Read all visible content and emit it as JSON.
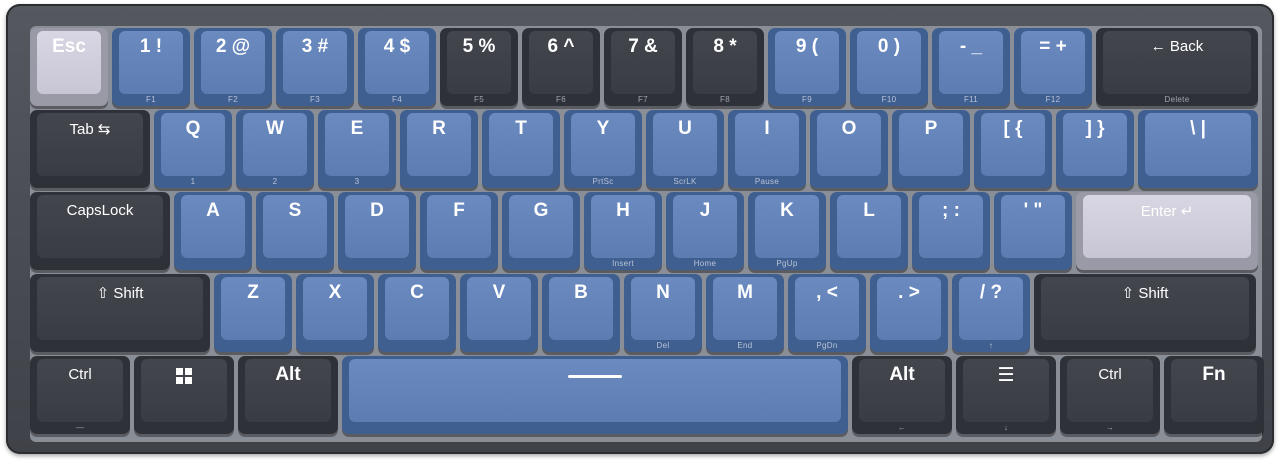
{
  "keyboard": {
    "rows": [
      [
        {
          "label": "Esc",
          "sub": "",
          "color": "light"
        },
        {
          "label": "1 !",
          "sub": "F1",
          "color": "blue"
        },
        {
          "label": "2 @",
          "sub": "F2",
          "color": "blue"
        },
        {
          "label": "3 #",
          "sub": "F3",
          "color": "blue"
        },
        {
          "label": "4 $",
          "sub": "F4",
          "color": "blue"
        },
        {
          "label": "5 %",
          "sub": "F5",
          "color": "dark"
        },
        {
          "label": "6 ^",
          "sub": "F6",
          "color": "dark"
        },
        {
          "label": "7 &",
          "sub": "F7",
          "color": "dark"
        },
        {
          "label": "8 *",
          "sub": "F8",
          "color": "dark"
        },
        {
          "label": "9 (",
          "sub": "F9",
          "color": "blue"
        },
        {
          "label": "0 )",
          "sub": "F10",
          "color": "blue"
        },
        {
          "label": "- _",
          "sub": "F11",
          "color": "blue"
        },
        {
          "label": "= +",
          "sub": "F12",
          "color": "blue"
        },
        {
          "label": "← Back",
          "sub": "Delete",
          "color": "dark"
        }
      ],
      [
        {
          "label": "Tab ⇆",
          "sub": "",
          "color": "dark"
        },
        {
          "label": "Q",
          "sub": "1",
          "color": "blue"
        },
        {
          "label": "W",
          "sub": "2",
          "color": "blue"
        },
        {
          "label": "E",
          "sub": "3",
          "color": "blue"
        },
        {
          "label": "R",
          "sub": "",
          "color": "blue"
        },
        {
          "label": "T",
          "sub": "",
          "color": "blue"
        },
        {
          "label": "Y",
          "sub": "PrtSc",
          "color": "blue"
        },
        {
          "label": "U",
          "sub": "ScrLK",
          "color": "blue"
        },
        {
          "label": "I",
          "sub": "Pause",
          "color": "blue"
        },
        {
          "label": "O",
          "sub": "",
          "color": "blue"
        },
        {
          "label": "P",
          "sub": "",
          "color": "blue"
        },
        {
          "label": "[ {",
          "sub": "",
          "color": "blue"
        },
        {
          "label": "] }",
          "sub": "",
          "color": "blue"
        },
        {
          "label": "\\ |",
          "sub": "",
          "color": "blue"
        }
      ],
      [
        {
          "label": "CapsLock",
          "sub": "",
          "color": "dark"
        },
        {
          "label": "A",
          "sub": "",
          "color": "blue"
        },
        {
          "label": "S",
          "sub": "",
          "color": "blue"
        },
        {
          "label": "D",
          "sub": "",
          "color": "blue"
        },
        {
          "label": "F",
          "sub": "",
          "color": "blue"
        },
        {
          "label": "G",
          "sub": "",
          "color": "blue"
        },
        {
          "label": "H",
          "sub": "Insert",
          "color": "blue"
        },
        {
          "label": "J",
          "sub": "Home",
          "color": "blue"
        },
        {
          "label": "K",
          "sub": "PgUp",
          "color": "blue"
        },
        {
          "label": "L",
          "sub": "",
          "color": "blue"
        },
        {
          "label": "; :",
          "sub": "",
          "color": "blue"
        },
        {
          "label": "' \"",
          "sub": "",
          "color": "blue"
        },
        {
          "label": "Enter ↵",
          "sub": "",
          "color": "light"
        }
      ],
      [
        {
          "label": "⇧ Shift",
          "sub": "",
          "color": "dark"
        },
        {
          "label": "Z",
          "sub": "",
          "color": "blue"
        },
        {
          "label": "X",
          "sub": "",
          "color": "blue"
        },
        {
          "label": "C",
          "sub": "",
          "color": "blue"
        },
        {
          "label": "V",
          "sub": "",
          "color": "blue"
        },
        {
          "label": "B",
          "sub": "",
          "color": "blue"
        },
        {
          "label": "N",
          "sub": "Del",
          "color": "blue"
        },
        {
          "label": "M",
          "sub": "End",
          "color": "blue"
        },
        {
          "label": ", <",
          "sub": "PgDn",
          "color": "blue"
        },
        {
          "label": ". >",
          "sub": "",
          "color": "blue"
        },
        {
          "label": "/ ?",
          "sub": "↑",
          "color": "blue"
        },
        {
          "label": "⇧ Shift",
          "sub": "",
          "color": "dark"
        }
      ],
      [
        {
          "label": "Ctrl",
          "sub": "—",
          "color": "dark"
        },
        {
          "label": "",
          "sub": "",
          "color": "dark",
          "icon": "windows-logo-icon"
        },
        {
          "label": "Alt",
          "sub": "",
          "color": "dark"
        },
        {
          "label": "",
          "sub": "",
          "color": "blue",
          "icon": "spacebar"
        },
        {
          "label": "Alt",
          "sub": "←",
          "color": "dark"
        },
        {
          "label": "☰",
          "sub": "↓",
          "color": "dark"
        },
        {
          "label": "Ctrl",
          "sub": "→",
          "color": "dark"
        },
        {
          "label": "Fn",
          "sub": "",
          "color": "dark"
        }
      ]
    ],
    "colors": {
      "body": "#3f4248",
      "dark": "#393c43",
      "blue": "#5c7cb2",
      "light": "#c8c6d4"
    }
  }
}
